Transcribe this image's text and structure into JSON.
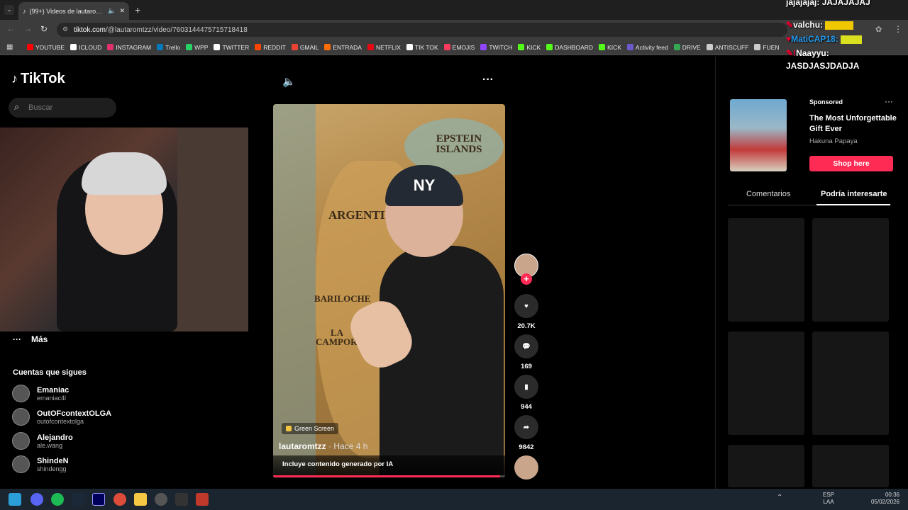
{
  "browser": {
    "tab_title": "(99+) Videos de lautaromtz…",
    "url_host": "tiktok.com",
    "url_path": "/@lautaromtzz/video/7603144475715718418",
    "bookmarks": [
      "YOUTUBE",
      "ICLOUD",
      "INSTAGRAM",
      "Trello",
      "WPP",
      "TWITTER",
      "REDDIT",
      "GMAIL",
      "ENTRADA",
      "NETFLIX",
      "TIK TOK",
      "EMOJIS",
      "TWITCH",
      "KICK",
      "DASHBOARD",
      "KICK",
      "Activity feed",
      "DRIVE",
      "ANTISCUFF",
      "FUEN"
    ],
    "bookmark_colors": [
      "#ff0000",
      "#ffffff",
      "#e1306c",
      "#0079bf",
      "#25d366",
      "#ffffff",
      "#ff4500",
      "#ea4335",
      "#ff6d00",
      "#e50914",
      "#ffffff",
      "#ff3b5c",
      "#9146ff",
      "#53fc18",
      "#53fc18",
      "#53fc18",
      "#6a5acd",
      "#34a853",
      "#cccccc",
      "#cccccc"
    ]
  },
  "tiktok": {
    "logo": "TikTok",
    "search_placeholder": "Buscar",
    "more": "Más",
    "following_header": "Cuentas que sigues",
    "accounts": [
      {
        "name": "Emaniac",
        "handle": "emaniac4l"
      },
      {
        "name": "OutOFcontextOLGA",
        "handle": "outofcontextolga"
      },
      {
        "name": "Alejandro",
        "handle": "ale.wang"
      },
      {
        "name": "ShindeN",
        "handle": "shindengg"
      }
    ]
  },
  "video": {
    "map_labels": {
      "epstein": "EPSTEIN ISLANDS",
      "argentina": "ARGENTIN",
      "bariloche": "BARILOCHE",
      "campora": "LA CAMPORA"
    },
    "effect": "Green Screen",
    "author": "lautaromtzz",
    "time": "· Hace 4 h",
    "ai_label": "Incluye contenido generado por IA",
    "progress": 0.98
  },
  "actions": {
    "likes": "20.7K",
    "comments": "169",
    "saves": "944",
    "shares": "9842"
  },
  "ad": {
    "sponsored": "Sponsored",
    "title": "The Most Unforgettable Gift Ever",
    "brand": "Hakuna Papaya",
    "cta": "Shop here"
  },
  "tabs": {
    "comments": "Comentarios",
    "related": "Podría interesarte"
  },
  "chat": [
    {
      "user": "jajajajaj:",
      "text": "JAJAJAJAJ"
    },
    {
      "user": "valchu:",
      "text": ""
    },
    {
      "user": "MatiCAP18:",
      "text": ""
    },
    {
      "user": "Naayyu:",
      "text": "JASDJASJDADJA"
    }
  ],
  "taskbar": {
    "lang1": "ESP",
    "lang2": "LAA",
    "time": "00:36",
    "date": "05/02/2026"
  }
}
